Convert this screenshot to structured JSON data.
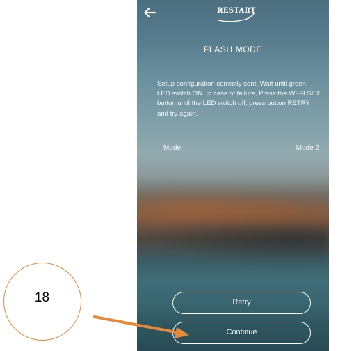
{
  "app": {
    "logo_text": "RESTART",
    "title": "FLASH MODE",
    "message": "Setup configuration correctly sent. Wait until green LED switch ON. In case of failure, Press the WI-FI SET button until the LED switch off, press button RETRY and try again."
  },
  "mode": {
    "label": "Mode",
    "value": "Mode 2"
  },
  "buttons": {
    "retry_label": "Retry",
    "continue_label": "Continue"
  },
  "annotation": {
    "number": "18"
  },
  "icons": {
    "back": "back-arrow-icon",
    "logo": "restart-logo"
  },
  "colors": {
    "annotation_orange": "#e58a3a",
    "text_white": "#ffffff"
  }
}
